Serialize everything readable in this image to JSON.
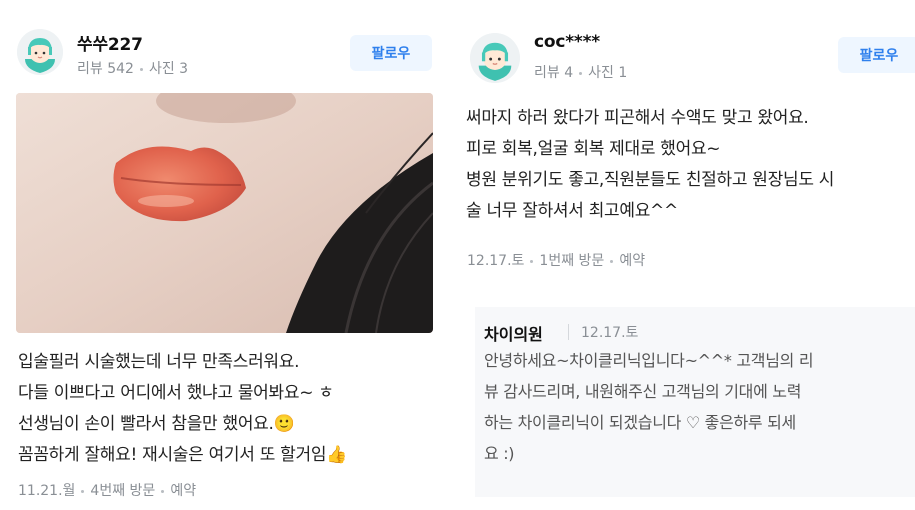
{
  "reviews": [
    {
      "username": "쑤쑤227",
      "review_count": "리뷰 542",
      "photo_count": "사진 3",
      "follow_label": "팔로우",
      "text_lines": [
        "입술필러 시술했는데 너무 만족스러워요.",
        "다들 이쁘다고 어디에서 했냐고 물어봐요~ ㅎ",
        "선생님이 손이 빨라서 참을만 했어요.🙂",
        "꼼꼼하게 잘해요! 재시술은 여기서 또 할거임👍"
      ],
      "date": "11.21.월",
      "visit": "4번째 방문",
      "type": "예약"
    },
    {
      "username": "coc****",
      "review_count": "리뷰 4",
      "photo_count": "사진 1",
      "follow_label": "팔로우",
      "text_lines": [
        "써마지 하러 왔다가 피곤해서 수액도 맞고 왔어요.",
        "피로 회복,얼굴 회복 제대로 했어요~",
        "병원 분위기도 좋고,직원분들도 친절하고 원장님도 시",
        "술 너무 잘하셔서 최고예요^^"
      ],
      "date": "12.17.토",
      "visit": "1번째 방문",
      "type": "예약",
      "reply": {
        "name": "차이의원",
        "date": "12.17.토",
        "lines": [
          "안녕하세요~차이클리닉입니다~^^* 고객님의 리",
          "뷰 감사드리며, 내원해주신 고객님의 기대에 노력",
          "하는 차이클리닉이 되겠습니다 ♡ 좋은하루 되세",
          "요 :)"
        ]
      }
    }
  ]
}
